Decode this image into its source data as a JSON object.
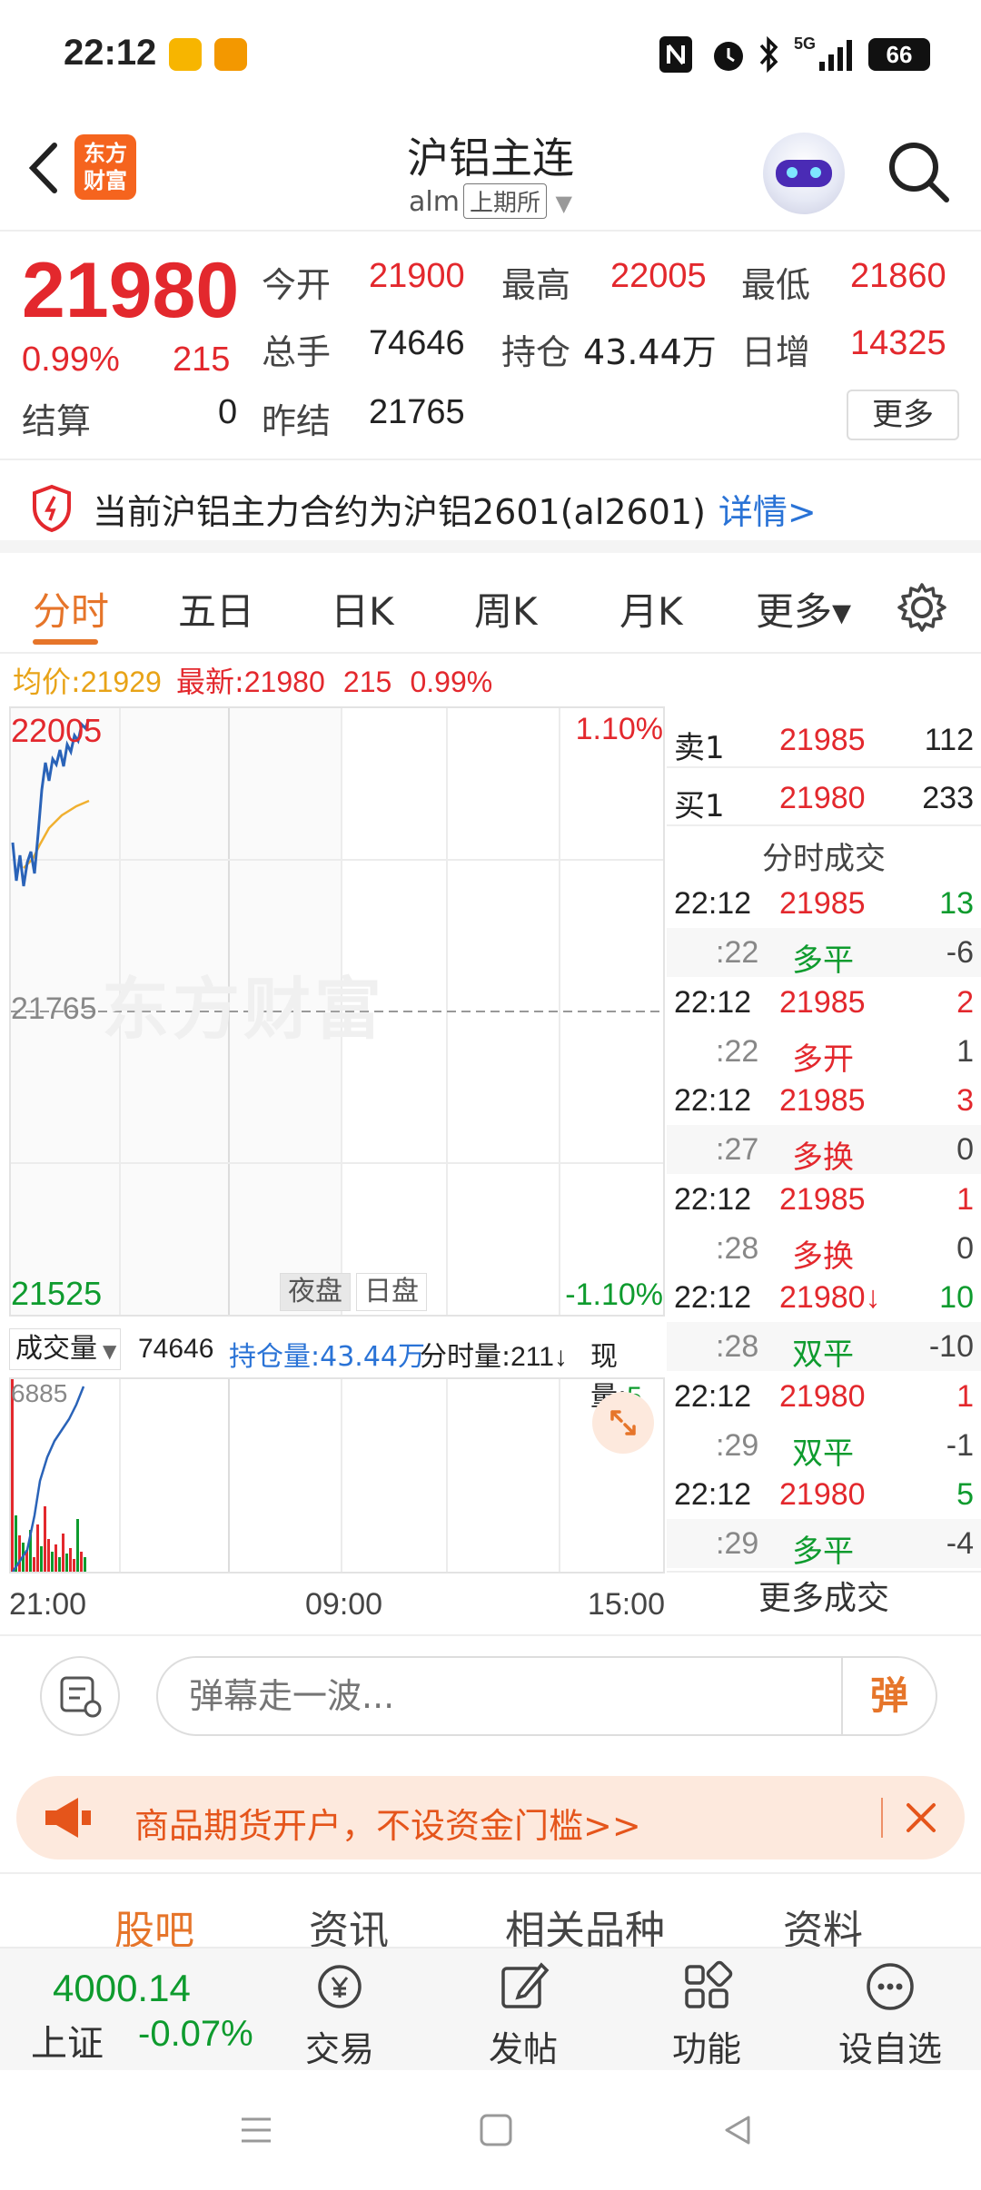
{
  "status": {
    "time": "22:12",
    "network": "5G",
    "battery": "66"
  },
  "header": {
    "logo": "东方财富",
    "title": "沪铝主连",
    "code": "alm",
    "exchange": "上期所"
  },
  "quote": {
    "price": "21980",
    "pct": "0.99%",
    "change": "215",
    "open_label": "今开",
    "open": "21900",
    "high_label": "最高",
    "high": "22005",
    "low_label": "最低",
    "low": "21860",
    "volume_label": "总手",
    "volume": "74646",
    "oi_label": "持仓",
    "oi": "43.44万",
    "daily_inc_label": "日增",
    "daily_inc": "14325",
    "settle_label": "结算",
    "settle": "0",
    "prev_settle_label": "昨结",
    "prev_settle": "21765",
    "more_label": "更多"
  },
  "notice": {
    "text": "当前沪铝主力合约为沪铝2601(al2601)",
    "link": "详情>"
  },
  "tabs": [
    "分时",
    "五日",
    "日K",
    "周K",
    "月K",
    "更多▾"
  ],
  "infoline": {
    "avg_label": "均价:",
    "avg": "21929",
    "latest_label": "最新:",
    "latest": "21980",
    "chg": "215",
    "pct": "0.99%"
  },
  "chart": {
    "price_top": "22005",
    "pct_top": "1.10%",
    "mid": "21765",
    "price_bottom": "21525",
    "pct_bottom": "-1.10%",
    "session_night": "夜盘",
    "session_day": "日盘",
    "watermark": "东方财富",
    "x_labels": [
      "21:00",
      "09:00",
      "15:00"
    ]
  },
  "chart_data": {
    "type": "line",
    "series": [
      {
        "name": "最新",
        "color": "#2a63b8"
      },
      {
        "name": "均价",
        "color": "#f0b030"
      }
    ],
    "ylim": [
      21525,
      22005
    ],
    "x_ticks": [
      "21:00",
      "09:00",
      "15:00"
    ],
    "volume_max": "6885"
  },
  "volume_bar": {
    "selector": "成交量",
    "total": "74646",
    "oi_label": "持仓量:",
    "oi": "43.44万",
    "minute_label": "分时量:",
    "minute": "211↓",
    "now_label": "现量:",
    "now": "5"
  },
  "orderbook": {
    "ask_label": "卖1",
    "ask_price": "21985",
    "ask_vol": "112",
    "bid_label": "买1",
    "bid_price": "21980",
    "bid_vol": "233"
  },
  "trades": {
    "title": "分时成交",
    "rows": [
      {
        "time": "22:12",
        "price": "21985",
        "vol": "13",
        "sec": ":22",
        "type": "多平",
        "oi": "-6"
      },
      {
        "time": "22:12",
        "price": "21985",
        "vol": "2",
        "sec": ":22",
        "type": "多开",
        "oi": "1"
      },
      {
        "time": "22:12",
        "price": "21985",
        "vol": "3",
        "sec": ":27",
        "type": "多换",
        "oi": "0"
      },
      {
        "time": "22:12",
        "price": "21985",
        "vol": "1",
        "sec": ":28",
        "type": "多换",
        "oi": "0"
      },
      {
        "time": "22:12",
        "price": "21980↓",
        "vol": "10",
        "sec": ":28",
        "type": "双平",
        "oi": "-10"
      },
      {
        "time": "22:12",
        "price": "21980",
        "vol": "1",
        "sec": ":29",
        "type": "双平",
        "oi": "-1"
      },
      {
        "time": "22:12",
        "price": "21980",
        "vol": "5",
        "sec": ":29",
        "type": "多平",
        "oi": "-4"
      }
    ],
    "more_label": "更多成交"
  },
  "comment": {
    "placeholder": "弹幕走一波...",
    "send": "弹"
  },
  "promo": {
    "text": "商品期货开户，不设资金门槛>>"
  },
  "subtabs": [
    "股吧",
    "资讯",
    "相关品种",
    "资料"
  ],
  "bottom": {
    "index_value": "4000.14",
    "index_name": "上证",
    "index_change": "-0.07%",
    "nav": [
      "交易",
      "发帖",
      "功能",
      "设自选"
    ]
  }
}
